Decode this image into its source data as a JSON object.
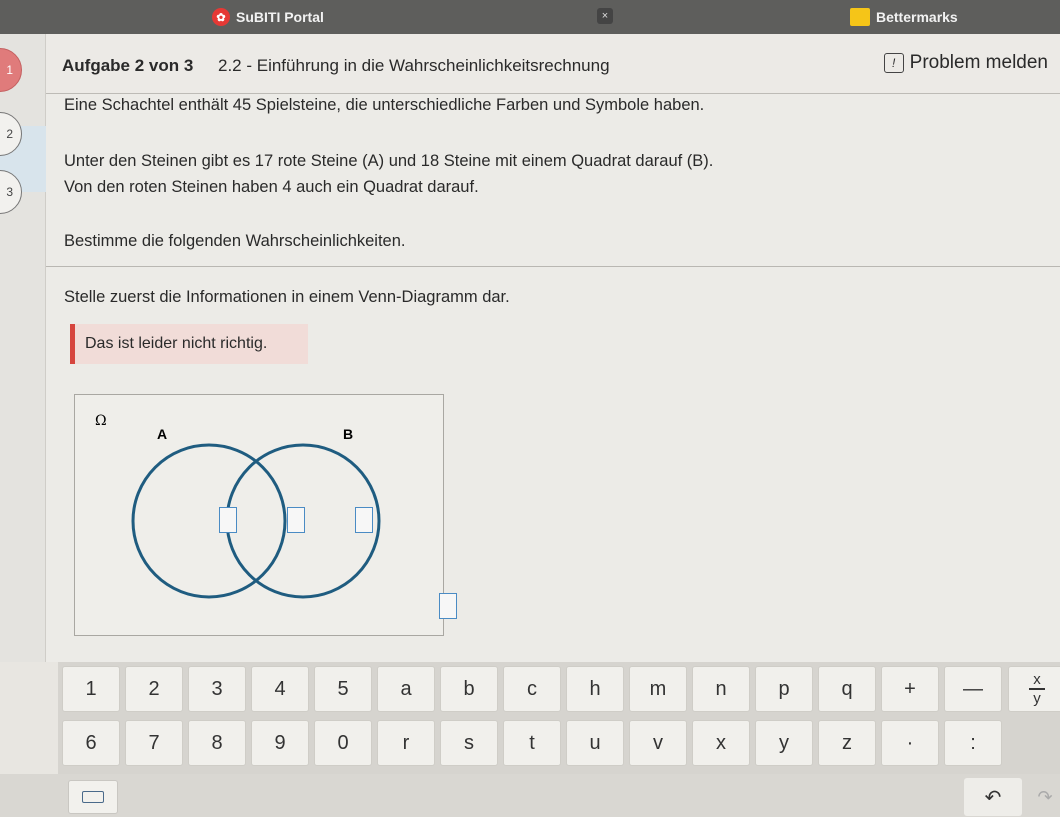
{
  "browser": {
    "tab1_title": "SuBITI Portal",
    "tab2_title": "Bettermarks",
    "close_glyph": "×"
  },
  "steps": [
    "1",
    "2",
    "3"
  ],
  "header": {
    "task_index": "Aufgabe 2 von 3",
    "task_title": "2.2 - Einführung in die Wahrscheinlichkeitsrechnung",
    "report_label": "Problem melden",
    "report_icon_glyph": "!"
  },
  "task": {
    "line1": "Eine Schachtel enthält 45 Spielsteine, die unterschiedliche Farben und Symbole haben.",
    "line2": "Unter den Steinen gibt es 17 rote Steine (A) und 18 Steine mit einem Quadrat darauf (B).",
    "line3": "Von den roten Steinen haben 4 auch ein Quadrat darauf.",
    "line4": "Bestimme die folgenden Wahrscheinlichkeiten.",
    "instruction": "Stelle zuerst die Informationen in einem Venn-Diagramm dar.",
    "feedback": "Das ist leider nicht richtig."
  },
  "venn": {
    "omega": "Ω",
    "label_a": "A",
    "label_b": "B",
    "circle_color": "#1f5c80",
    "input_border": "#4a8bc4"
  },
  "keyboard": {
    "row1": [
      "1",
      "2",
      "3",
      "4",
      "5",
      "a",
      "b",
      "c",
      "h",
      "m",
      "n",
      "p",
      "q",
      "+",
      "—"
    ],
    "row2": [
      "6",
      "7",
      "8",
      "9",
      "0",
      "r",
      "s",
      "t",
      "u",
      "v",
      "x",
      "y",
      "z",
      "·",
      ":"
    ],
    "fraction_numerator": "x",
    "fraction_denominator": "y",
    "undo_glyph": "↶",
    "redo_glyph": "↷"
  },
  "colors": {
    "error_accent": "#d6453e",
    "error_bg": "#f1dcd8",
    "active_step": "#e07b7b"
  }
}
